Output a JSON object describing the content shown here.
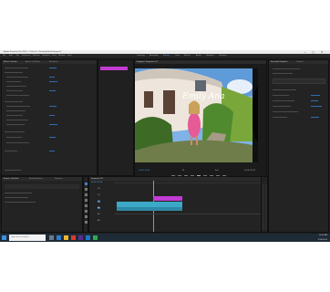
{
  "window": {
    "title": "Adobe Premiere Pro 2020 - C:\\Users\\...\\Desktop\\Untitled.prproj *",
    "minimize_glyph": "—",
    "maximize_glyph": "□",
    "close_glyph": "✕"
  },
  "menu": [
    "File",
    "Edit",
    "Clip",
    "Sequence",
    "Markers",
    "Graphics",
    "View",
    "Window",
    "Help"
  ],
  "workspaces": [
    "Learning",
    "Assembly",
    "Editing",
    "Color",
    "Effects",
    "Audio",
    "Graphics",
    "Libraries"
  ],
  "effect_controls": {
    "tabs": [
      "Effect Controls",
      "Audio Clip Mixer",
      "Metadata"
    ]
  },
  "program_monitor": {
    "tab": "Program: Sequence 01",
    "overlay_text": "Emily Ana",
    "timecode": "00:00:12:04",
    "fit": "Fit",
    "quality": "Full",
    "duration": "00:00:31:21"
  },
  "essential_graphics": {
    "tabs": [
      "Essential Graphics",
      "Lumetri"
    ]
  },
  "project": {
    "tabs": [
      "Project: Untitled",
      "Media Browser",
      "Libraries"
    ]
  },
  "timeline": {
    "tab": "Sequence 01",
    "timecode": "00:00:12:04",
    "tracks": [
      "V3",
      "V2",
      "V1",
      "A1",
      "A2",
      "A3"
    ]
  },
  "taskbar": {
    "search_placeholder": "Type here to search",
    "time": "10:42 AM",
    "date": "5/14/2020"
  },
  "colors": {
    "accent_pink": "#c23bd3",
    "clip_cyan": "#3ba9c7",
    "timeline_blue": "#2f6db3"
  }
}
